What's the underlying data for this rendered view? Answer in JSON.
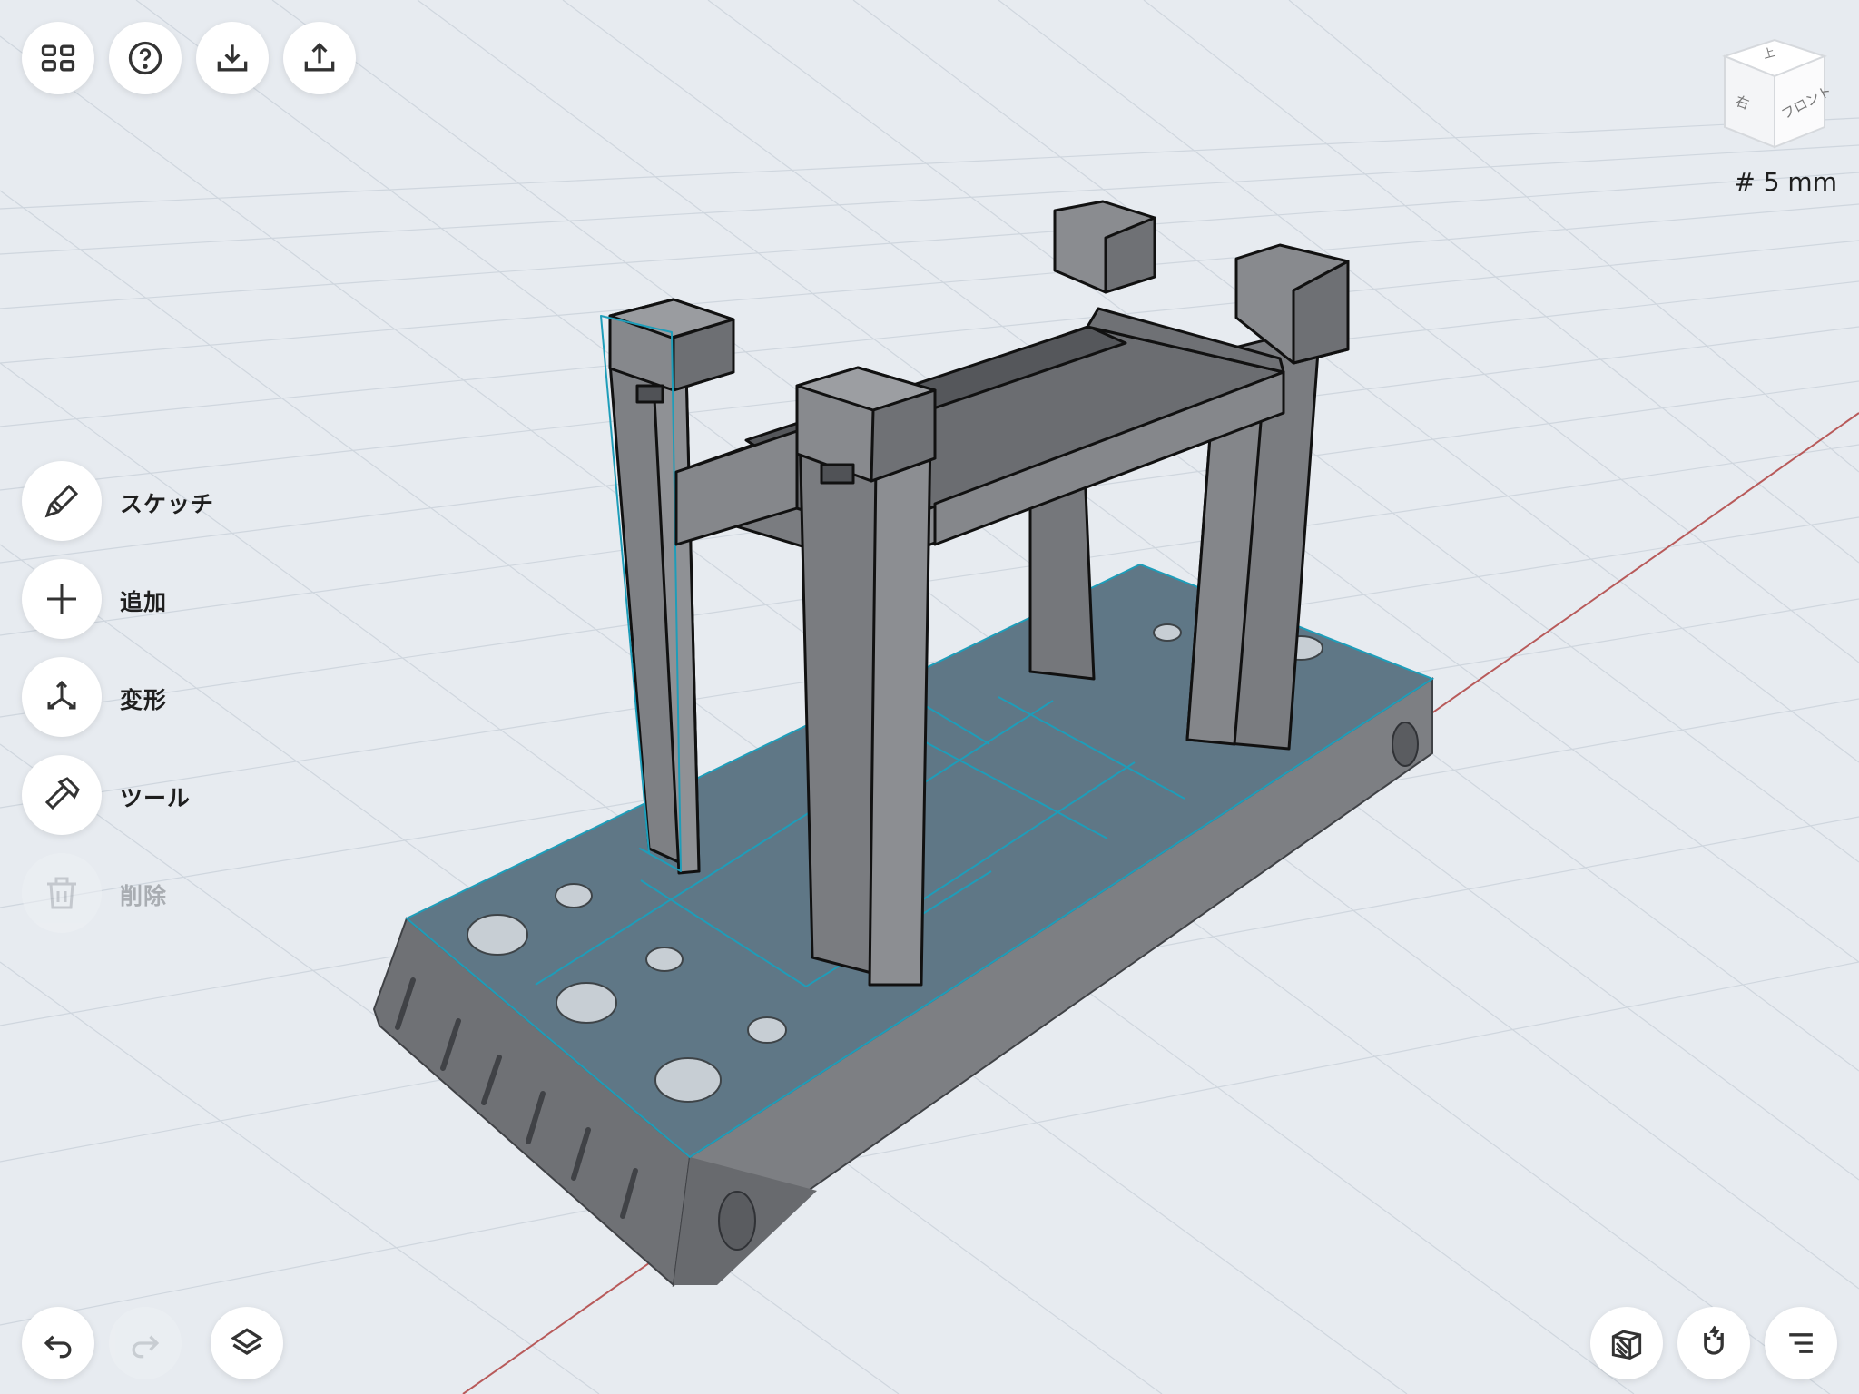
{
  "top_toolbar": {
    "buttons": [
      {
        "name": "grid-menu",
        "icon": "grid-icon"
      },
      {
        "name": "help",
        "icon": "help-icon"
      },
      {
        "name": "import",
        "icon": "download-icon"
      },
      {
        "name": "export",
        "icon": "share-icon"
      }
    ]
  },
  "tools": {
    "sketch": "スケッチ",
    "add": "追加",
    "transform": "変形",
    "tools": "ツール",
    "delete": "削除"
  },
  "view_cube": {
    "top": "上",
    "right": "右",
    "front": "フロント"
  },
  "grid_size": "# 5 mm",
  "bottom_toolbar": {
    "undo": "undo-icon",
    "redo": "redo-icon",
    "layers": "layers-icon",
    "display_mode": "shaded-cube-icon",
    "snap": "magnet-icon",
    "settings": "list-icon"
  },
  "colors": {
    "accent": "#1e9db9",
    "background": "#e3e8ee",
    "model": "#7a7c80",
    "selection": "#1e9db9"
  }
}
